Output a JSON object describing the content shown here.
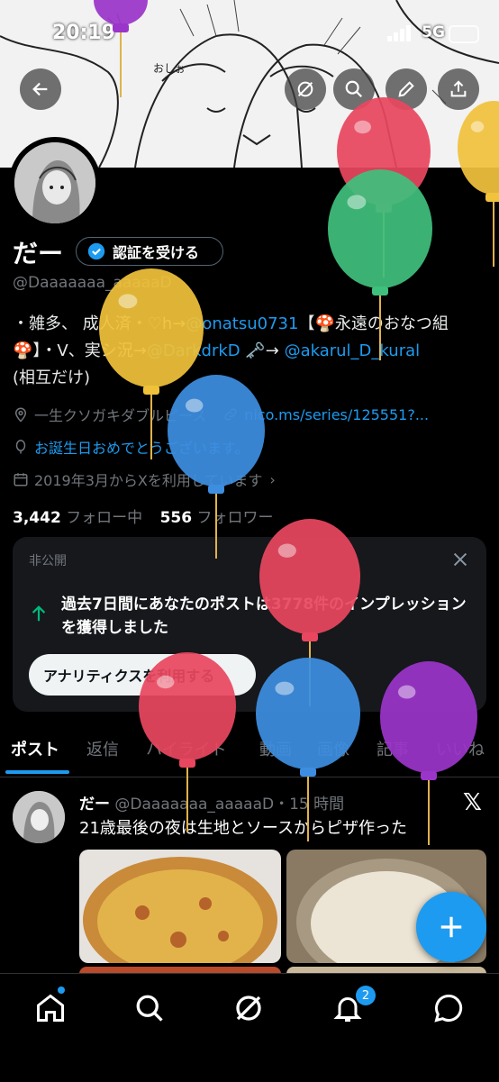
{
  "status_bar": {
    "time": "20:19",
    "network": "5G"
  },
  "profile": {
    "name": "だー",
    "verify_label": "認証を受ける",
    "handle": "@Daaaaaaa_aaaaaD",
    "bio": {
      "t1": "・雑多、 成人済・♡h→",
      "l1": "@onatsu0731",
      "t2": "【🍄永遠のおなつ組🍄】・V、実シ況→",
      "l2": "@DarkdrkD",
      "t3": " 🗝️→ ",
      "l3": "@akarul_D_kural",
      "t4": "(相互だけ)"
    },
    "location": "一生クソガキダブルピース",
    "website": "nico.ms/series/125551?...",
    "birthday": "お誕生日おめでとうございます。",
    "joined": "2019年3月からXを利用しています",
    "following_count": "3,442",
    "following_label": "フォロー中",
    "followers_count": "556",
    "followers_label": "フォロワー"
  },
  "analytics_card": {
    "label": "非公開",
    "message_pre": "過去7日間にあなたのポストは",
    "count": "3778件",
    "message_post": "のインプレッションを獲得しました",
    "button": "アナリティクスを利用する"
  },
  "tabs": [
    "ポスト",
    "返信",
    "ハイライト",
    "動画",
    "画像",
    "記事",
    "いいね"
  ],
  "post": {
    "name": "だー",
    "handle": "@Daaaaaaa_aaaaaD",
    "time": "・15 時間",
    "text": "21歳最後の夜は生地とソースからピザ作った"
  },
  "notifications_badge": "2",
  "colors": {
    "accent": "#1d9bf0",
    "background": "#000000",
    "card": "#16181c"
  },
  "balloons": [
    {
      "color": "#e8475f"
    },
    {
      "color": "#3fc07c"
    },
    {
      "color": "#f0c23a"
    },
    {
      "color": "#f1c23c"
    },
    {
      "color": "#3d8ee0"
    },
    {
      "color": "#e8475f"
    },
    {
      "color": "#e8475f"
    },
    {
      "color": "#3d8ee0"
    },
    {
      "color": "#9b35c9"
    },
    {
      "color": "#9b35c9"
    }
  ]
}
